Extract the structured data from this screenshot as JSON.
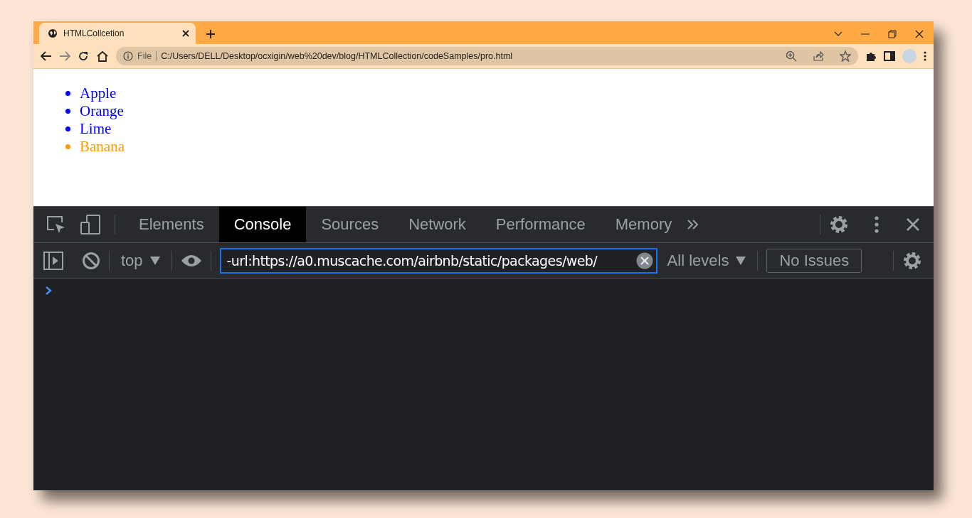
{
  "browser": {
    "tab": {
      "title": "HTMLCollcetion"
    },
    "address": {
      "scheme_label": "File",
      "url": "C:/Users/DELL/Desktop/ocxigin/web%20dev/blog/HTMLCollection/codeSamples/pro.html"
    }
  },
  "page": {
    "list_items": [
      {
        "text": "Apple",
        "color": "#0000ff"
      },
      {
        "text": "Orange",
        "color": "#0000ff"
      },
      {
        "text": "Lime",
        "color": "#0000ff"
      },
      {
        "text": "Banana",
        "color": "#ff9900"
      }
    ]
  },
  "devtools": {
    "tabs": [
      {
        "label": "Elements",
        "selected": false
      },
      {
        "label": "Console",
        "selected": true
      },
      {
        "label": "Sources",
        "selected": false
      },
      {
        "label": "Network",
        "selected": false
      },
      {
        "label": "Performance",
        "selected": false
      },
      {
        "label": "Memory",
        "selected": false
      }
    ],
    "context": "top",
    "filter": {
      "value": "-url:https://a0.muscache.com/airbnb/static/packages/web/"
    },
    "levels": "All levels",
    "issues": "No Issues"
  }
}
